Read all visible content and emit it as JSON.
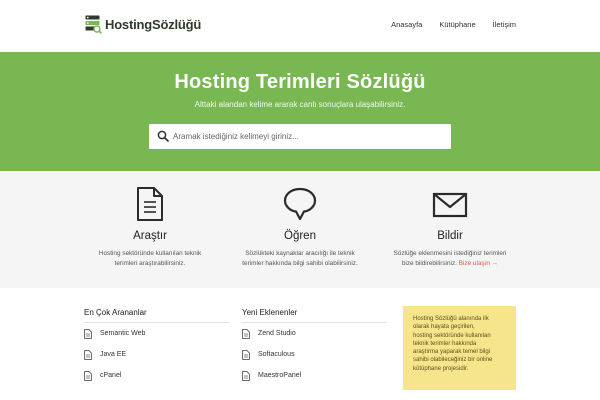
{
  "header": {
    "logo_text": "HostingSözlüğü",
    "nav": [
      {
        "label": "Anasayfa"
      },
      {
        "label": "Kütüphane"
      },
      {
        "label": "İletişim"
      }
    ]
  },
  "hero": {
    "title": "Hosting Terimleri Sözlüğü",
    "subtitle": "Alttaki alandan kelime ararak canlı sonuçlara ulaşabilirsiniz.",
    "search": {
      "placeholder": "Aramak istediğiniz kelimeyi giriniz..."
    },
    "background_color": "#79b752"
  },
  "features": [
    {
      "icon": "document-icon",
      "title": "Araştır",
      "desc_line1": "Hosting sektöründe kullanılan teknik",
      "desc_line2": "terimleri araştırabilirsiniz."
    },
    {
      "icon": "speech-bubble-icon",
      "title": "Öğren",
      "desc_line1": "Sözlükteki kaynaklar aracılığı ile teknik",
      "desc_line2": "terimler hakkında bilgi sahibi olabilirsiniz."
    },
    {
      "icon": "envelope-icon",
      "title": "Bildir",
      "desc_line1": "Sözlüğe eklenmesini istediğiniz terimleri",
      "desc_line2": "bize bildirebilirsiniz.",
      "link": "Bize ulaşın →"
    }
  ],
  "most_searched": {
    "title": "En Çok Arananlar",
    "items": [
      {
        "label": "Semantic Web"
      },
      {
        "label": "Java EE"
      },
      {
        "label": "cPanel"
      }
    ]
  },
  "recently_added": {
    "title": "Yeni Eklenenler",
    "items": [
      {
        "label": "Zend Studio"
      },
      {
        "label": "Softaculous"
      },
      {
        "label": "MaestroPanel"
      }
    ]
  },
  "note": {
    "lines": [
      "Hosting Sözlüğü alanında ilk",
      "olarak hayata geçirilen,",
      "hosting sektöründe kullanılan",
      "teknik terimler hakkında",
      "araştırma yaparak temel bilgi",
      "sahibi olabileceğiniz bir online",
      "kütüphane projesidir."
    ],
    "background_color": "#f6e58a"
  },
  "colors": {
    "accent": "#79b752",
    "link": "#e05a3a",
    "icon_dark": "#2c2c2c"
  }
}
